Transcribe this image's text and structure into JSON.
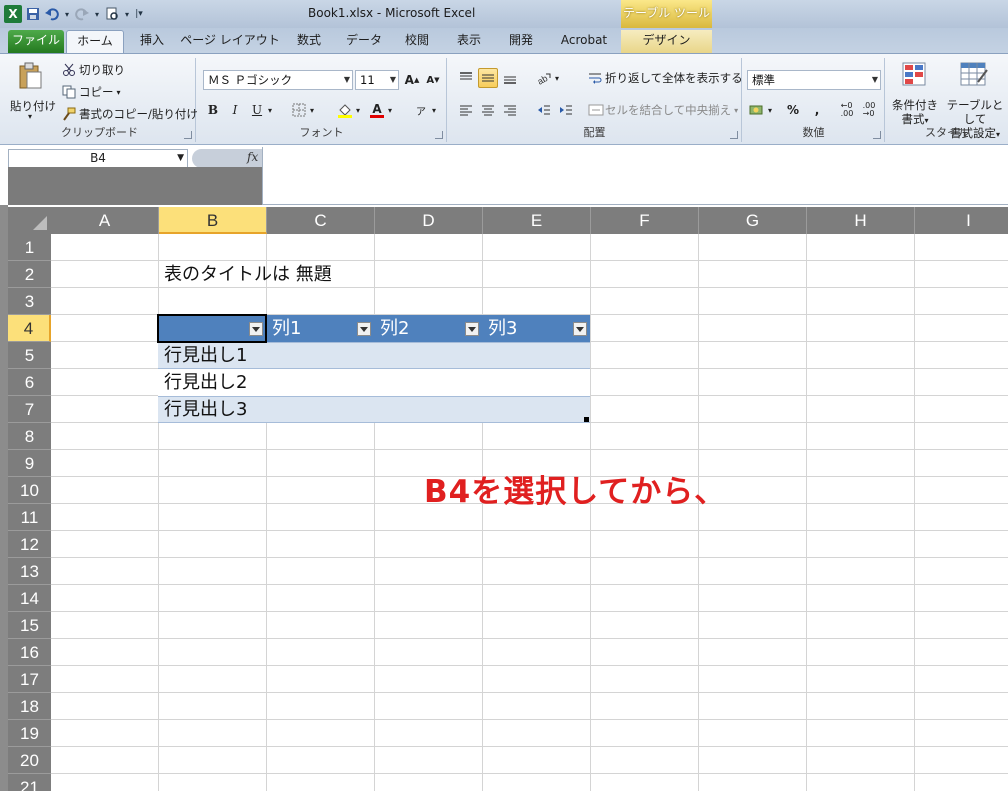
{
  "window": {
    "title": "Book1.xlsx  -  Microsoft Excel",
    "context_tab_header": "テーブル ツール"
  },
  "quick_access": {
    "icons": [
      "excel-logo-icon",
      "save-icon",
      "undo-icon",
      "redo-icon",
      "print-preview-icon",
      "customize-qat-icon"
    ]
  },
  "tabs": [
    "ファイル",
    "ホーム",
    "挿入",
    "ページ レイアウト",
    "数式",
    "データ",
    "校閲",
    "表示",
    "開発",
    "Acrobat",
    "デザイン"
  ],
  "ribbon": {
    "clipboard": {
      "label": "クリップボード",
      "paste": "貼り付け",
      "cut": "切り取り",
      "copy": "コピー",
      "format_painter": "書式のコピー/貼り付け"
    },
    "font": {
      "label": "フォント",
      "font_name": "ＭＳ Ｐゴシック",
      "font_size": "11",
      "bold": "B",
      "italic": "I",
      "underline": "U",
      "font_color_glyph": "A"
    },
    "alignment": {
      "label": "配置",
      "wrap_text": "折り返して全体を表示する",
      "merge_center": "セルを結合して中央揃え"
    },
    "number": {
      "label": "数値",
      "format": "標準",
      "percent": "%",
      "comma": ","
    },
    "styles": {
      "label": "スタイル",
      "conditional_line1": "条件付き",
      "conditional_line2": "書式",
      "table_format_line1": "テーブルとして",
      "table_format_line2": "書式設定"
    }
  },
  "formula_bar": {
    "name_box": "B4",
    "fx": "fx",
    "content": ""
  },
  "grid": {
    "columns": [
      "A",
      "B",
      "C",
      "D",
      "E",
      "F",
      "G",
      "H",
      "I"
    ],
    "selected_column": "B",
    "rows": [
      "1",
      "2",
      "3",
      "4",
      "5",
      "6",
      "7",
      "8",
      "9",
      "10",
      "11",
      "12",
      "13",
      "14",
      "15",
      "16",
      "17",
      "18",
      "19",
      "20",
      "21"
    ],
    "selected_row": "4",
    "title_cell": "表のタイトルは 無題",
    "table": {
      "headers": [
        "",
        "列1",
        "列2",
        "列3"
      ],
      "row_headers": [
        "行見出し1",
        "行見出し2",
        "行見出し3"
      ],
      "header_color": "#4f81bd",
      "band_color": "#dbe5f1"
    }
  },
  "annotation": {
    "text": "B4を選択してから、",
    "color": "#e02020"
  }
}
